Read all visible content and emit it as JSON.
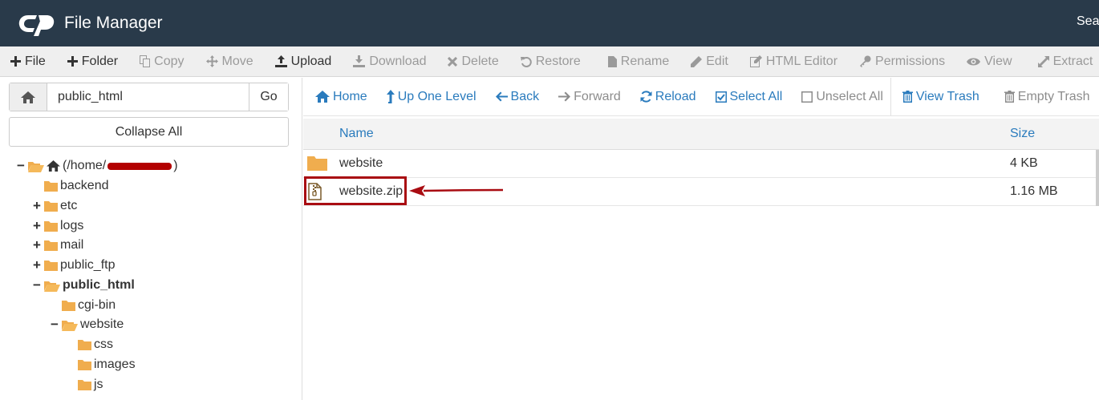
{
  "header": {
    "app_title": "File Manager",
    "search_label": "Search"
  },
  "toolbar": {
    "items": [
      {
        "label": "File",
        "icon": "plus-icon",
        "enabled": true
      },
      {
        "label": "Folder",
        "icon": "plus-icon",
        "enabled": true
      },
      {
        "label": "Copy",
        "icon": "copy-icon",
        "enabled": false
      },
      {
        "label": "Move",
        "icon": "move-icon",
        "enabled": false
      },
      {
        "label": "Upload",
        "icon": "upload-icon",
        "enabled": true
      },
      {
        "label": "Download",
        "icon": "download-icon",
        "enabled": false
      },
      {
        "label": "Delete",
        "icon": "times-icon",
        "enabled": false
      },
      {
        "label": "Restore",
        "icon": "undo-icon",
        "enabled": false
      },
      {
        "label": "Rename",
        "icon": "file-icon",
        "enabled": false
      },
      {
        "label": "Edit",
        "icon": "pencil-icon",
        "enabled": false
      },
      {
        "label": "HTML Editor",
        "icon": "edit-icon",
        "enabled": false
      },
      {
        "label": "Permissions",
        "icon": "key-icon",
        "enabled": false
      },
      {
        "label": "View",
        "icon": "eye-icon",
        "enabled": false
      },
      {
        "label": "Extract",
        "icon": "expand-icon",
        "enabled": false
      }
    ]
  },
  "left_panel": {
    "path_value": "public_html",
    "go_label": "Go",
    "collapse_label": "Collapse All",
    "tree": [
      {
        "toggle": "−",
        "label": "(/home/",
        "suffix": ")",
        "icon": "home-icon",
        "open": true,
        "redacted": true
      },
      {
        "toggle": "",
        "label": "backend"
      },
      {
        "toggle": "+",
        "label": "etc"
      },
      {
        "toggle": "+",
        "label": "logs"
      },
      {
        "toggle": "+",
        "label": "mail"
      },
      {
        "toggle": "+",
        "label": "public_ftp"
      },
      {
        "toggle": "−",
        "label": "public_html",
        "bold": true,
        "open": true
      },
      {
        "toggle": "",
        "label": "cgi-bin"
      },
      {
        "toggle": "−",
        "label": "website",
        "open": true
      },
      {
        "toggle": "",
        "label": "css"
      },
      {
        "toggle": "",
        "label": "images"
      },
      {
        "toggle": "",
        "label": "js"
      }
    ]
  },
  "nav": {
    "items": [
      {
        "label": "Home",
        "icon": "home-icon",
        "enabled": true
      },
      {
        "label": "Up One Level",
        "icon": "level-up-icon",
        "enabled": true
      },
      {
        "label": "Back",
        "icon": "arrow-left-icon",
        "enabled": true
      },
      {
        "label": "Forward",
        "icon": "arrow-right-icon",
        "enabled": false
      },
      {
        "label": "Reload",
        "icon": "refresh-icon",
        "enabled": true
      },
      {
        "label": "Select All",
        "icon": "checkbox-checked-icon",
        "enabled": true
      },
      {
        "label": "Unselect All",
        "icon": "checkbox-empty-icon",
        "enabled": false
      },
      {
        "label": "View Trash",
        "icon": "trash-icon",
        "enabled": true
      },
      {
        "label": "Empty Trash",
        "icon": "trash-icon",
        "enabled": false
      }
    ]
  },
  "table": {
    "columns": {
      "name": "Name",
      "size": "Size"
    },
    "rows": [
      {
        "name": "website",
        "size": "4 KB",
        "icon": "folder-icon"
      },
      {
        "name": "website.zip",
        "size": "1.16 MB",
        "icon": "zip-file-icon"
      }
    ]
  },
  "colors": {
    "header_bg": "#293a4a",
    "link_blue": "#2a7bbd",
    "folder_orange": "#f0ad4e",
    "annotation_red": "#a90c12"
  }
}
